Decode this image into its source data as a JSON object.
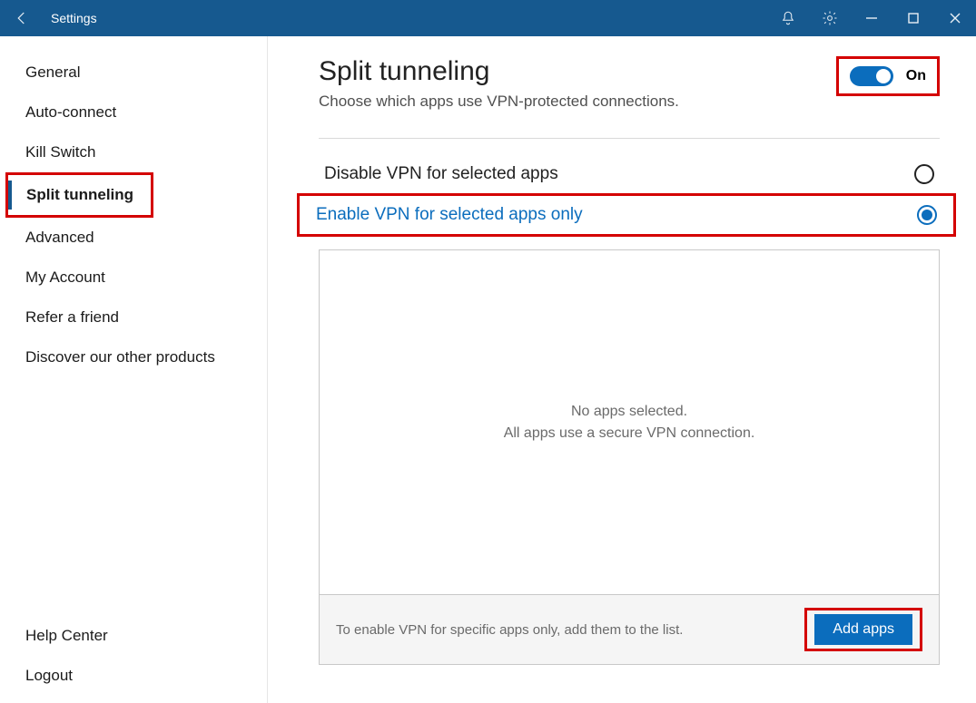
{
  "titlebar": {
    "back_aria": "Back",
    "title": "Settings",
    "icons": {
      "bell": "notifications",
      "gear": "settings",
      "min": "minimize",
      "max": "restore",
      "close": "close"
    }
  },
  "sidebar": {
    "items": [
      {
        "label": "General"
      },
      {
        "label": "Auto-connect"
      },
      {
        "label": "Kill Switch"
      },
      {
        "label": "Split tunneling",
        "active": true,
        "highlight": true
      },
      {
        "label": "Advanced"
      },
      {
        "label": "My Account"
      },
      {
        "label": "Refer a friend"
      },
      {
        "label": "Discover our other products"
      }
    ],
    "bottom": [
      {
        "label": "Help Center"
      },
      {
        "label": "Logout"
      }
    ]
  },
  "content": {
    "heading": "Split tunneling",
    "subtitle": "Choose which apps use VPN-protected connections.",
    "toggle_on": true,
    "toggle_label": "On",
    "options": [
      {
        "label": "Disable VPN for selected apps",
        "selected": false
      },
      {
        "label": "Enable VPN for selected apps only",
        "selected": true,
        "highlight": true
      }
    ],
    "apps": {
      "empty_line1": "No apps selected.",
      "empty_line2": "All apps use a secure VPN connection.",
      "footer_note": "To enable VPN for specific apps only, add them to the list.",
      "add_button": "Add apps",
      "add_highlight": true
    }
  }
}
